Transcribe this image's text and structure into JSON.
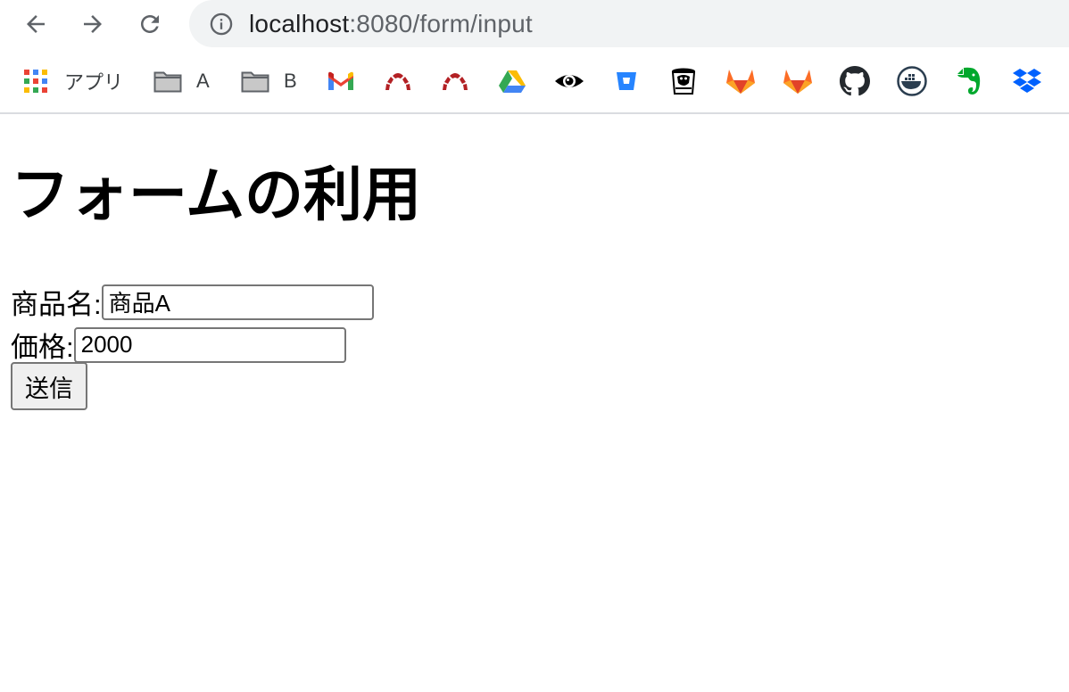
{
  "browser": {
    "url_host": "localhost",
    "url_path": ":8080/form/input",
    "back_icon": "arrow-left-icon",
    "forward_icon": "arrow-right-icon",
    "reload_icon": "reload-icon",
    "info_icon": "info-circle-icon"
  },
  "bookmarks": [
    {
      "label": "アプリ",
      "icon": "apps-grid-icon"
    },
    {
      "label": "A",
      "icon": "folder-icon"
    },
    {
      "label": "B",
      "icon": "folder-icon"
    },
    {
      "label": "",
      "icon": "gmail-icon"
    },
    {
      "label": "",
      "icon": "redmine-icon"
    },
    {
      "label": "",
      "icon": "redmine-icon"
    },
    {
      "label": "",
      "icon": "google-drive-icon"
    },
    {
      "label": "",
      "icon": "eye-icon"
    },
    {
      "label": "",
      "icon": "bitbucket-icon"
    },
    {
      "label": "",
      "icon": "jenkins-icon"
    },
    {
      "label": "",
      "icon": "gitlab-icon"
    },
    {
      "label": "",
      "icon": "gitlab-icon"
    },
    {
      "label": "",
      "icon": "github-icon"
    },
    {
      "label": "",
      "icon": "docker-icon"
    },
    {
      "label": "",
      "icon": "evernote-icon"
    },
    {
      "label": "",
      "icon": "dropbox-icon"
    }
  ],
  "page": {
    "title": "フォームの利用",
    "form": {
      "product_label": "商品名:",
      "product_value": "商品A",
      "price_label": "価格:",
      "price_value": "2000",
      "submit_label": "送信"
    }
  },
  "colors": {
    "omnibox_bg": "#f1f3f4",
    "gitlab_orange": "#e24329",
    "redmine_red": "#b32024",
    "github_black": "#24292e",
    "evernote_green": "#00a82d",
    "dropbox_blue": "#0061fe",
    "bitbucket_blue": "#2684ff"
  }
}
